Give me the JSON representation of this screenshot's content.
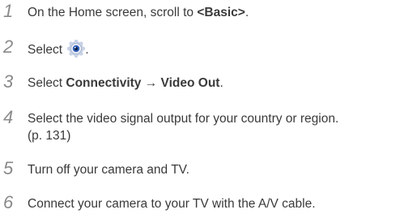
{
  "steps": [
    {
      "number": "1",
      "prefix": "On the Home screen, scroll to ",
      "bold": "<Basic>",
      "suffix": "."
    },
    {
      "number": "2",
      "prefix": "Select ",
      "icon": "settings-gear-icon",
      "suffix": "."
    },
    {
      "number": "3",
      "prefix": "Select ",
      "bold1": "Connectivity",
      "arrow": " → ",
      "bold2": "Video Out",
      "suffix": "."
    },
    {
      "number": "4",
      "line1": "Select the video signal output for your country or region.",
      "line2": "(p. 131)"
    },
    {
      "number": "5",
      "text": "Turn off your camera and TV."
    },
    {
      "number": "6",
      "text": "Connect your camera to your TV with the A/V cable."
    }
  ],
  "colors": {
    "step_number": "#8a8a8a",
    "body_text": "#3a3a3a",
    "icon_blue": "#2f5fb8"
  }
}
